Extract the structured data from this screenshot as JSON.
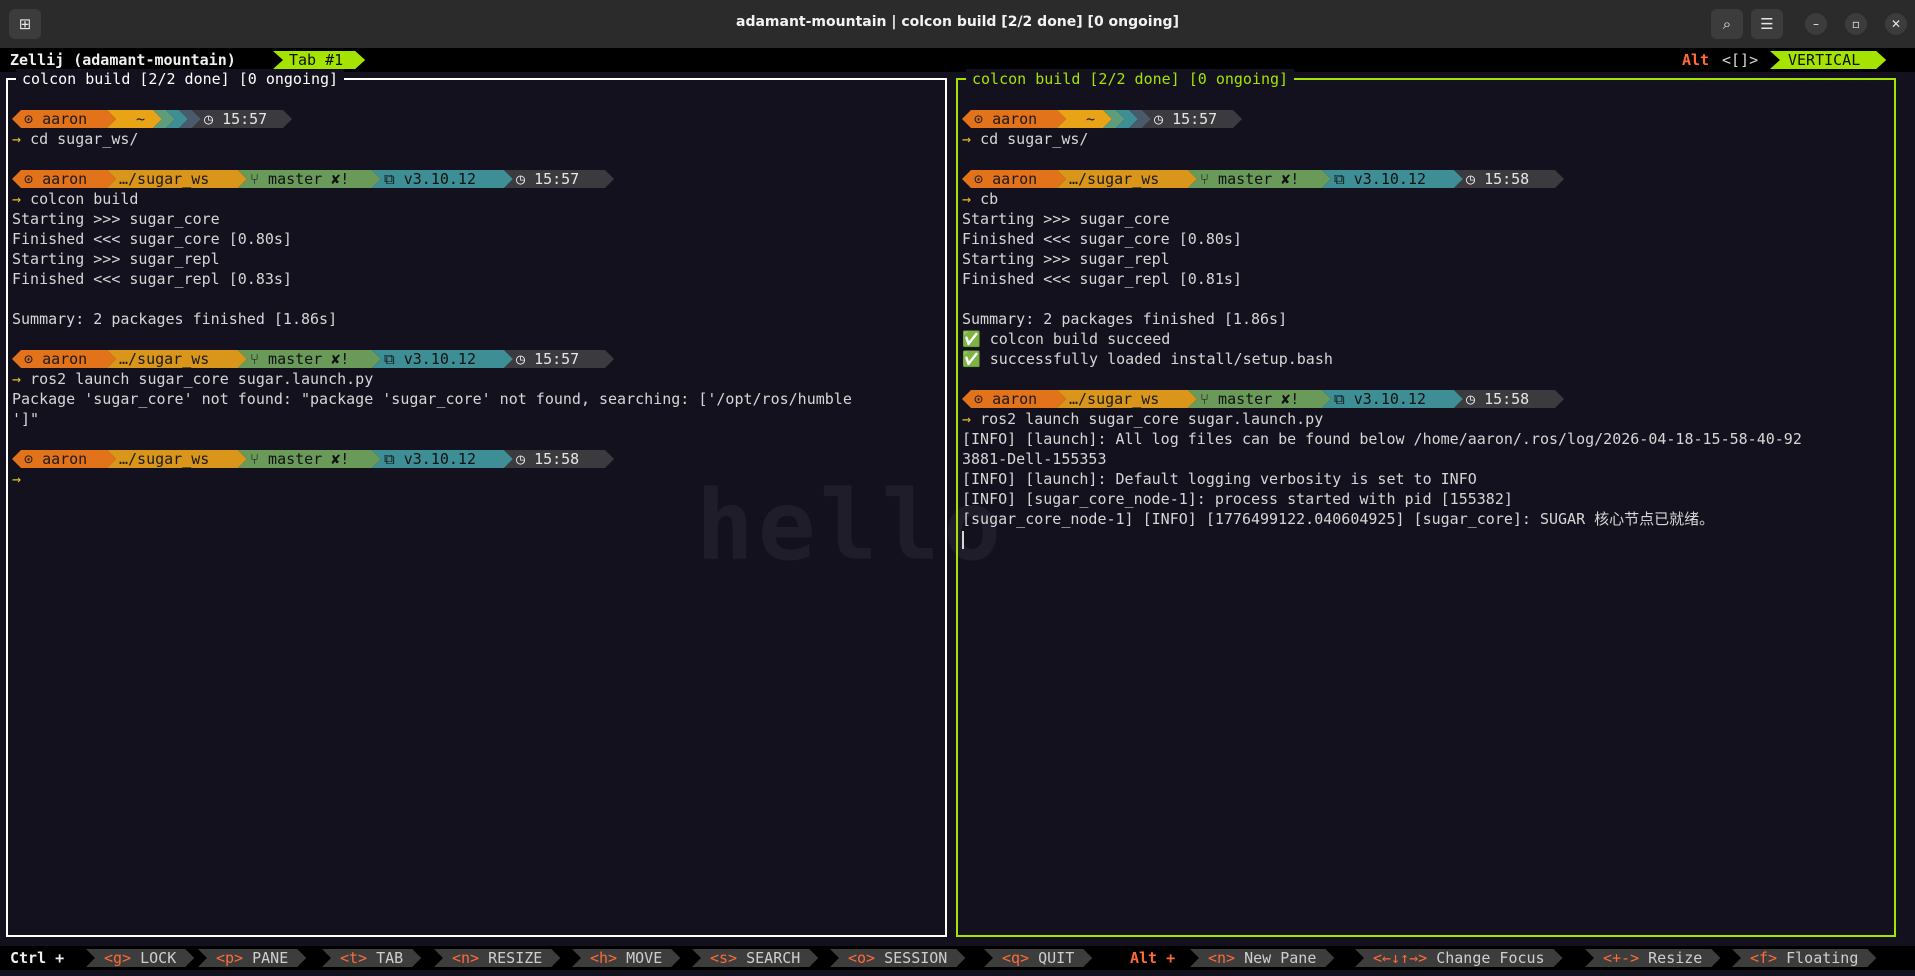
{
  "window": {
    "title": "adamant-mountain | colcon build [2/2 done] [0 ongoing]",
    "new_tab_icon": "new-tab-icon",
    "search_icon": "search-icon",
    "menu_icon": "hamburger-menu-icon",
    "minimize": "–",
    "maximize": "▫",
    "close": "✕"
  },
  "zellij": {
    "session_label": "Zellij (adamant-mountain)",
    "tab_label": "Tab #1",
    "alt_label": "Alt",
    "swap_hint": "<[]>",
    "layout_label": "VERTICAL"
  },
  "prompt_common": {
    "user": "aaron",
    "home": "~",
    "dir": "…/sugar_ws",
    "branch": "master ✘!",
    "python": "v3.10.12"
  },
  "left_pane": {
    "title": "colcon build [2/2 done] [0 ongoing]",
    "p1_time": "15:57",
    "cmd1": "cd sugar_ws/",
    "p2_time": "15:57",
    "cmd2": "colcon build",
    "out2": [
      "Starting >>> sugar_core",
      "Finished <<< sugar_core [0.80s]",
      "Starting >>> sugar_repl",
      "Finished <<< sugar_repl [0.83s]",
      "",
      "Summary: 2 packages finished [1.86s]"
    ],
    "p3_time": "15:57",
    "cmd3": "ros2 launch sugar_core sugar.launch.py",
    "out3": [
      "Package 'sugar_core' not found: \"package 'sugar_core' not found, searching: ['/opt/ros/humble",
      "']\""
    ],
    "p4_time": "15:58",
    "watermark": "hello"
  },
  "right_pane": {
    "title": "colcon build [2/2 done] [0 ongoing]",
    "p1_time": "15:57",
    "cmd1": "cd sugar_ws/",
    "p2_time": "15:58",
    "cmd2": "cb",
    "out2": [
      "Starting >>> sugar_core",
      "Finished <<< sugar_core [0.80s]",
      "Starting >>> sugar_repl",
      "Finished <<< sugar_repl [0.81s]",
      "",
      "Summary: 2 packages finished [1.86s]",
      "✅ colcon build succeed",
      "✅ successfully loaded install/setup.bash"
    ],
    "p3_time": "15:58",
    "cmd3": "ros2 launch sugar_core sugar.launch.py",
    "out3": [
      "[INFO] [launch]: All log files can be found below /home/aaron/.ros/log/2026-04-18-15-58-40-92",
      "3881-Dell-155353",
      "[INFO] [launch]: Default logging verbosity is set to INFO",
      "[INFO] [sugar_core_node-1]: process started with pid [155382]",
      "[sugar_core_node-1] [INFO] [1776499122.040604925] [sugar_core]: SUGAR 核心节点已就绪。"
    ]
  },
  "statusbar": {
    "ctrl_label": "Ctrl +",
    "items": [
      {
        "key": "<g>",
        "label": "LOCK"
      },
      {
        "key": "<p>",
        "label": "PANE"
      },
      {
        "key": "<t>",
        "label": "TAB"
      },
      {
        "key": "<n>",
        "label": "RESIZE"
      },
      {
        "key": "<h>",
        "label": "MOVE"
      },
      {
        "key": "<s>",
        "label": "SEARCH"
      },
      {
        "key": "<o>",
        "label": "SESSION"
      },
      {
        "key": "<q>",
        "label": "QUIT"
      }
    ],
    "alt_label": "Alt +",
    "alt_items": [
      {
        "key": "<n>",
        "label": "New Pane"
      },
      {
        "key": "<←↓↑→>",
        "label": "Change Focus"
      },
      {
        "key": "<+->",
        "label": "Resize"
      },
      {
        "key": "<f>",
        "label": "Floating"
      }
    ]
  },
  "colors": {
    "accent_green": "#a4e400",
    "accent_orange": "#ff6b37",
    "background": "#13111d"
  }
}
